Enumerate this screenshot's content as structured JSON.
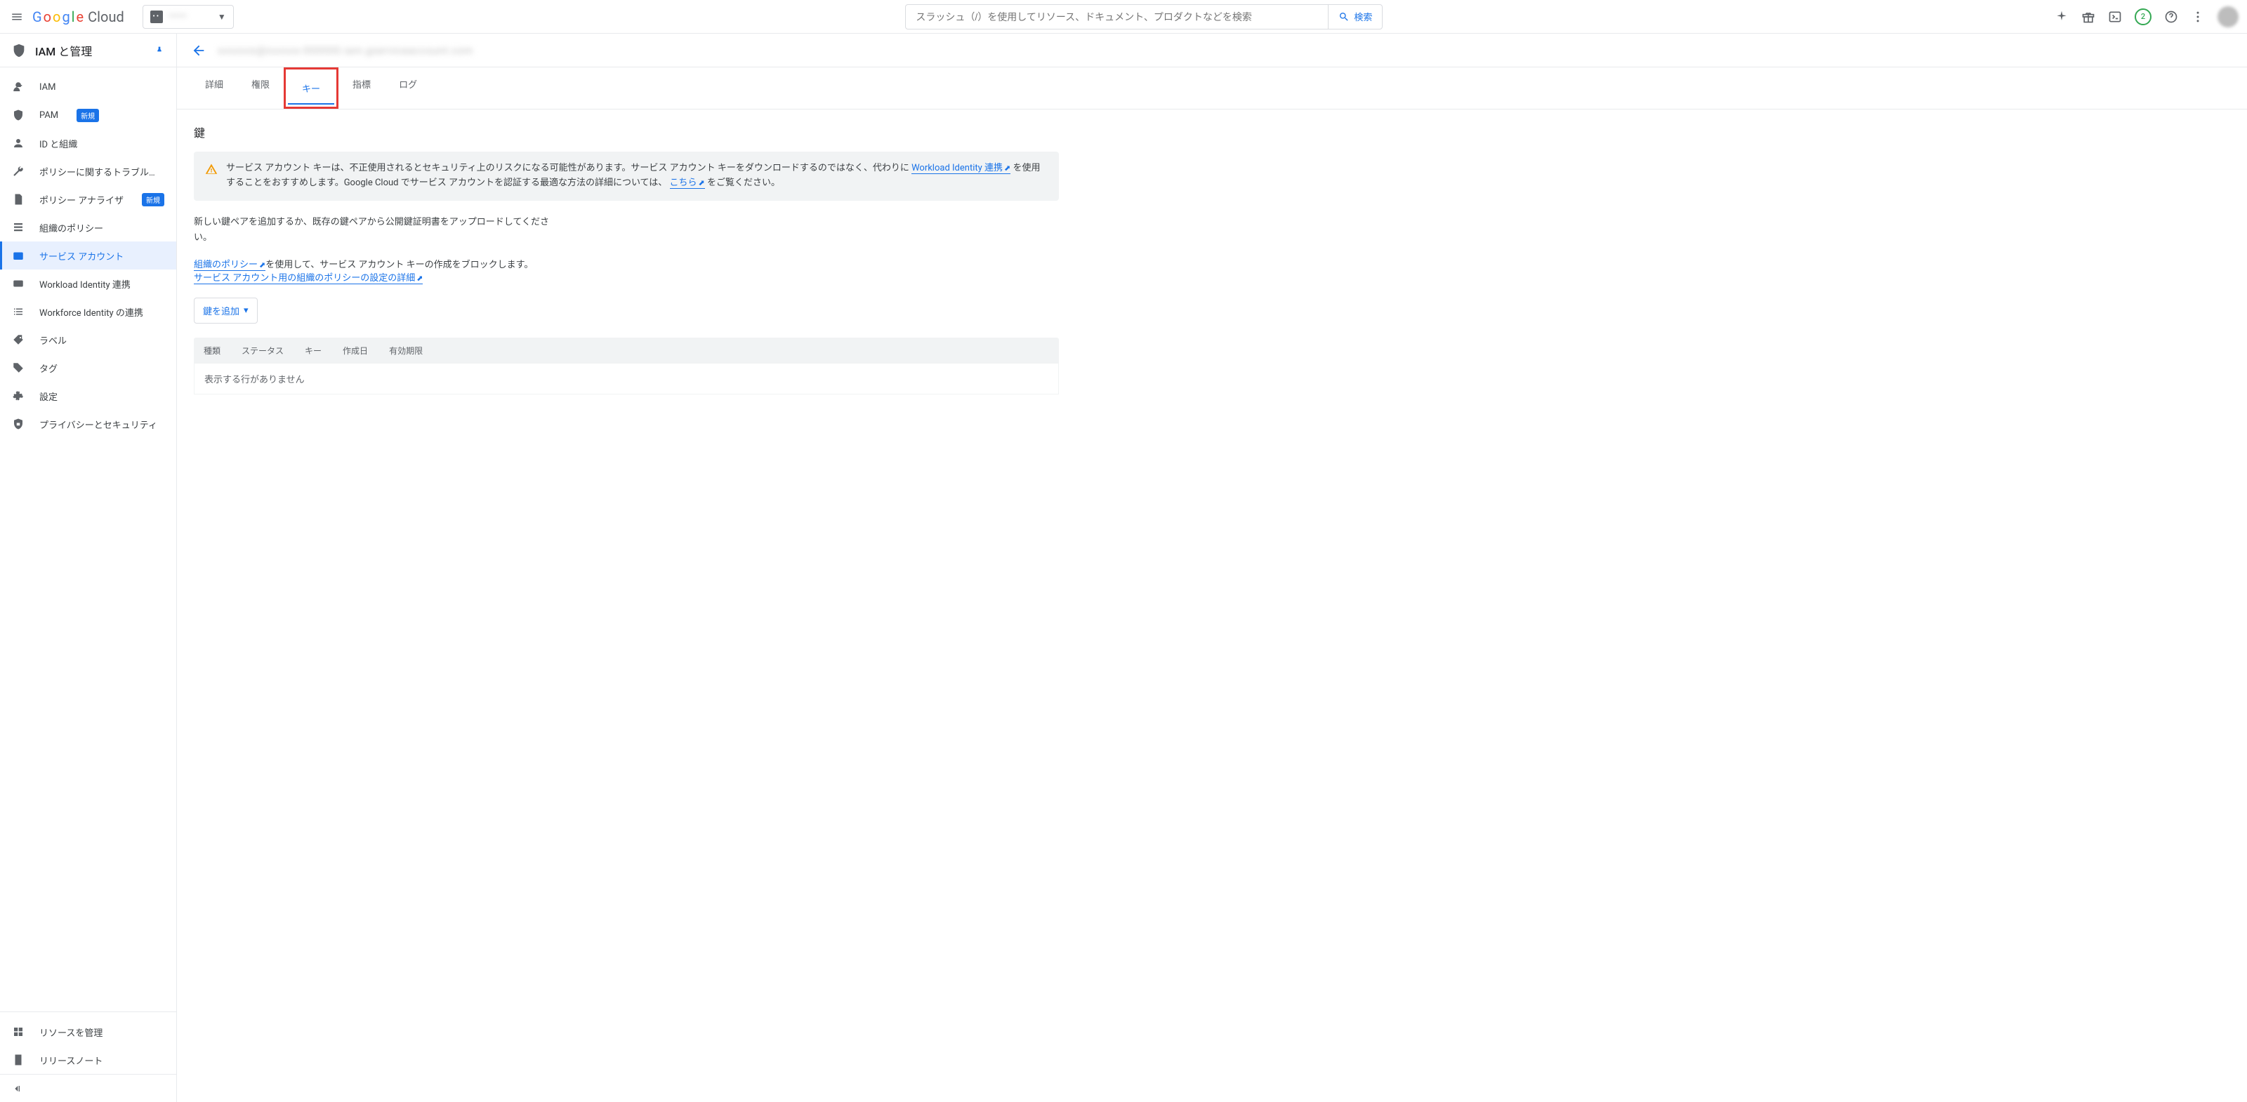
{
  "topbar": {
    "logo_text": "Google Cloud",
    "project_name": "••••••",
    "search_placeholder": "スラッシュ（/）を使用してリソース、ドキュメント、プロダクトなどを検索",
    "search_button": "検索",
    "badge_count": "2"
  },
  "sidebar": {
    "section_title": "IAM と管理",
    "items": [
      {
        "label": "IAM",
        "icon": "person-add"
      },
      {
        "label": "PAM",
        "icon": "shield",
        "badge": "新規"
      },
      {
        "label": "ID と組織",
        "icon": "account-circle"
      },
      {
        "label": "ポリシーに関するトラブル…",
        "icon": "wrench"
      },
      {
        "label": "ポリシー アナライザ",
        "icon": "doc",
        "badge": "新規"
      },
      {
        "label": "組織のポリシー",
        "icon": "list-doc"
      },
      {
        "label": "サービス アカウント",
        "icon": "badge-id",
        "active": true
      },
      {
        "label": "Workload Identity 連携",
        "icon": "card"
      },
      {
        "label": "Workforce Identity の連携",
        "icon": "list"
      },
      {
        "label": "ラベル",
        "icon": "tag"
      },
      {
        "label": "タグ",
        "icon": "tag-solid"
      },
      {
        "label": "設定",
        "icon": "gear"
      },
      {
        "label": "プライバシーとセキュリティ",
        "icon": "shield-lock"
      }
    ],
    "footer_items": [
      {
        "label": "リソースを管理",
        "icon": "grid"
      },
      {
        "label": "リリースノート",
        "icon": "note"
      }
    ]
  },
  "main": {
    "tabs": [
      "詳細",
      "権限",
      "キー",
      "指標",
      "ログ"
    ],
    "active_tab": "キー",
    "section_title": "鍵",
    "warning": {
      "text_prefix": "サービス アカウント キーは、不正使用されるとセキュリティ上のリスクになる可能性があります。サービス アカウント キーをダウンロードするのではなく、代わりに",
      "link1": "Workload Identity 連携",
      "text_mid": "を使用することをおすすめします。Google Cloud でサービス アカウントを認証する最適な方法の詳細については、",
      "link2": "こちら",
      "text_suffix": "をご覧ください。"
    },
    "description": "新しい鍵ペアを追加するか、既存の鍵ペアから公開鍵証明書をアップロードしてください。",
    "policy_link_text": "組織のポリシー",
    "policy_text_suffix": "を使用して、サービス アカウント キーの作成をブロックします。",
    "policy_detail_link": "サービス アカウント用の組織のポリシーの設定の詳細",
    "add_key_button": "鍵を追加",
    "table": {
      "columns": [
        "種類",
        "ステータス",
        "キー",
        "作成日",
        "有効期限"
      ],
      "empty_message": "表示する行がありません"
    }
  }
}
